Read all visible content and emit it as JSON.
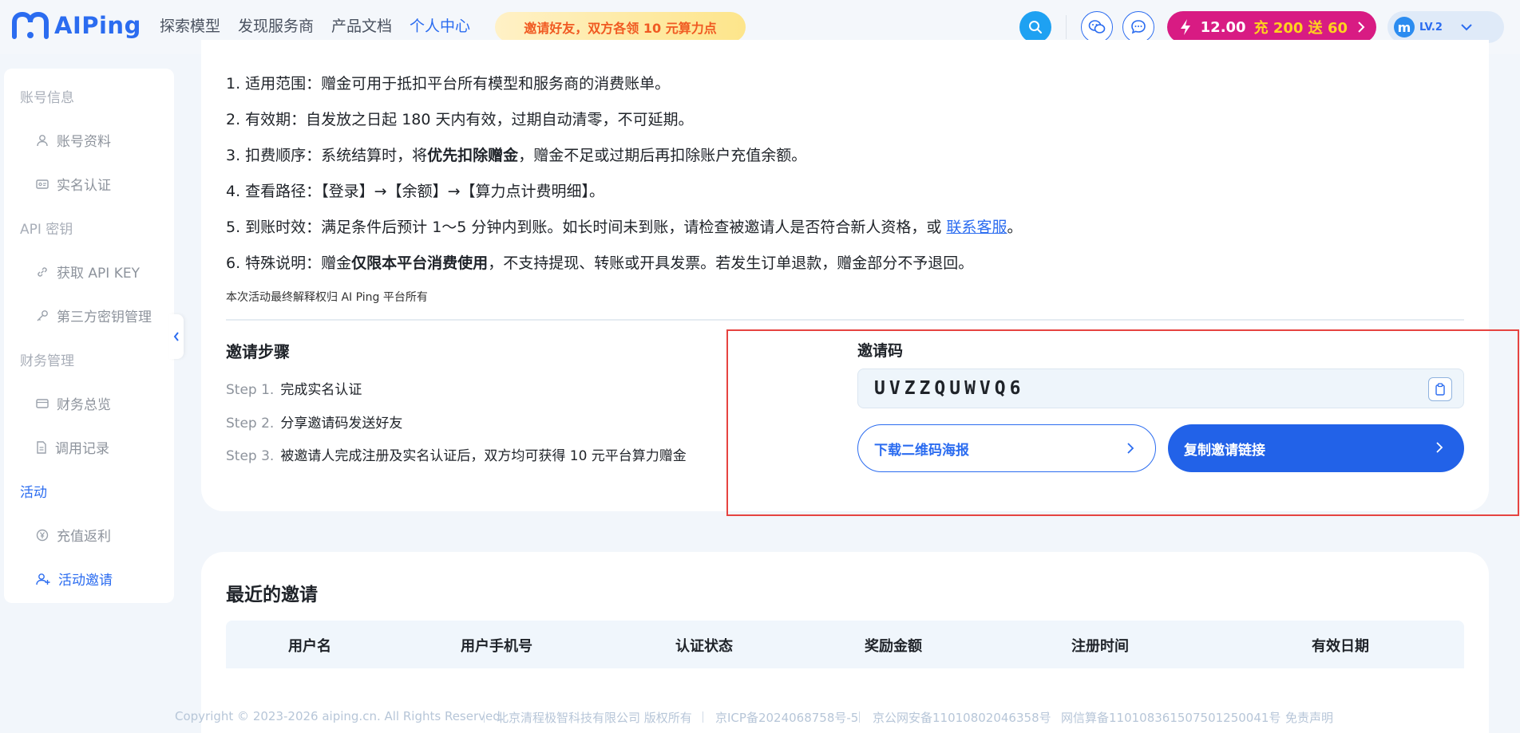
{
  "header": {
    "logo_text": "AIPing",
    "nav": [
      {
        "label": "探索模型"
      },
      {
        "label": "发现服务商"
      },
      {
        "label": "产品文档"
      },
      {
        "label": "个人中心",
        "active": true
      }
    ],
    "promo": "邀请好友，双方各领 10 元算力点",
    "credit_amount": "12.00",
    "credit_promo": "充 200 送 60",
    "avatar_letter": "m",
    "user_level": "LV.2"
  },
  "sidebar": {
    "groups": {
      "account": "账号信息",
      "api": "API 密钥",
      "finance": "财务管理",
      "activity": "活动"
    },
    "items": {
      "profile": "账号资料",
      "realname": "实名认证",
      "get_api_key": "获取 API KEY",
      "third_party_keys": "第三方密钥管理",
      "finance_overview": "财务总览",
      "call_records": "调用记录",
      "recharge_rebate": "充值返利",
      "activity_invite": "活动邀请"
    }
  },
  "rules": {
    "r1": "1. 适用范围：赠金可用于抵扣平台所有模型和服务商的消费账单。",
    "r2": "2. 有效期：自发放之日起 180 天内有效，过期自动清零，不可延期。",
    "r3_pre": "3. 扣费顺序：系统结算时，将",
    "r3_bold": "优先扣除赠金",
    "r3_post": "，赠金不足或过期后再扣除账户充值余额。",
    "r4": "4. 查看路径：【登录】→【余额】→【算力点计费明细】。",
    "r5_pre": "5. 到账时效：满足条件后预计 1～5 分钟内到账。如长时间未到账，请检查被邀请人是否符合新人资格，或 ",
    "r5_link": "联系客服",
    "r5_post": "。",
    "r6_pre": "6. 特殊说明：赠金",
    "r6_bold": "仅限本平台消费使用",
    "r6_post": "，不支持提现、转账或开具发票。若发生订单退款，赠金部分不予退回。",
    "footnote": "本次活动最终解释权归 AI Ping 平台所有"
  },
  "steps": {
    "title": "邀请步骤",
    "list": [
      {
        "num": "Step 1.",
        "text": "完成实名认证"
      },
      {
        "num": "Step 2.",
        "text": "分享邀请码发送好友"
      },
      {
        "num": "Step 3.",
        "text": "被邀请人完成注册及实名认证后，双方均可获得 10 元平台算力赠金"
      }
    ]
  },
  "invite": {
    "label": "邀请码",
    "code": "UVZZQUWVQ6",
    "download_btn": "下载二维码海报",
    "copy_btn": "复制邀请链接"
  },
  "recent": {
    "title": "最近的邀请",
    "columns": [
      "用户名",
      "用户手机号",
      "认证状态",
      "奖励金额",
      "注册时间",
      "有效日期"
    ]
  },
  "footer": {
    "copyright": "Copyright © 2023-2026 aiping.cn. All Rights Reserved.",
    "company": "北京清程极智科技有限公司 版权所有",
    "icp": "京ICP备2024068758号-5",
    "police": "京公网安备11010802046358号",
    "algo": "网信算备110108361507501250041号",
    "disclaimer": "免责声明"
  },
  "colors": {
    "accent": "#2b6cf0",
    "credit_pill": "#d81b83",
    "highlight_border": "#e64340"
  }
}
